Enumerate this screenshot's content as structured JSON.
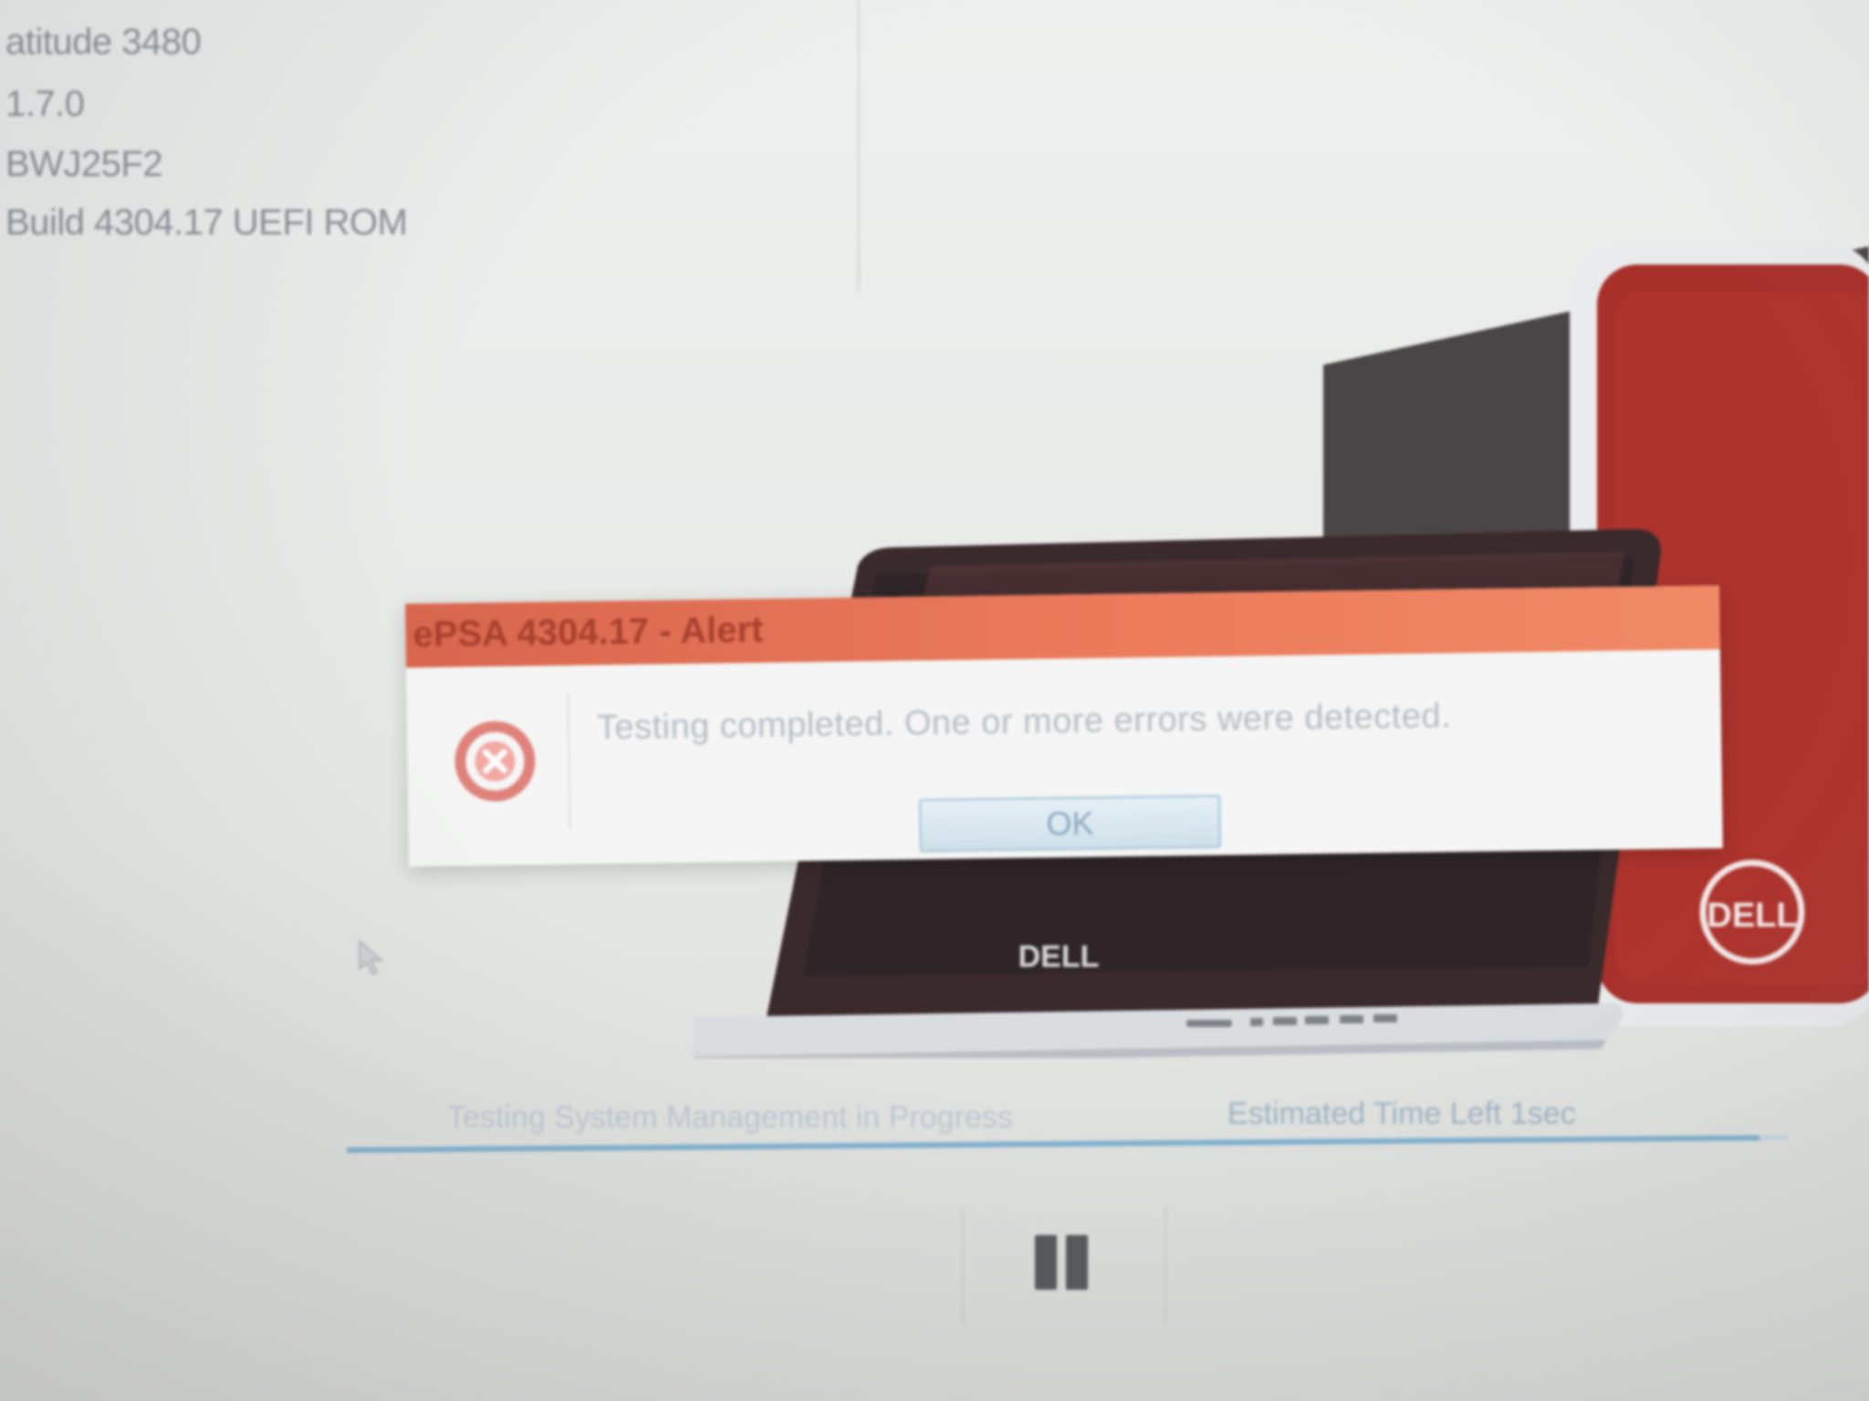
{
  "system_info": {
    "lines": [
      "atitude 3480",
      "1.7.0",
      "BWJ25F2",
      "Build  4304.17 UEFI ROM"
    ]
  },
  "illustration": {
    "brand_logo_text": "DELL",
    "tower_color": "#a8302b",
    "laptop_color": "#3a2a2c"
  },
  "alert": {
    "title": "ePSA 4304.17 - Alert",
    "icon": "error-x-icon",
    "message": "Testing completed. One or more errors were detected.",
    "ok_label": "OK",
    "title_color": "#ec7c5c"
  },
  "progress": {
    "status_text": "Testing System Management in Progress",
    "time_left": "Estimated Time Left 1sec",
    "fraction": 0.98
  },
  "controls": {
    "pause_icon": "pause-icon"
  }
}
